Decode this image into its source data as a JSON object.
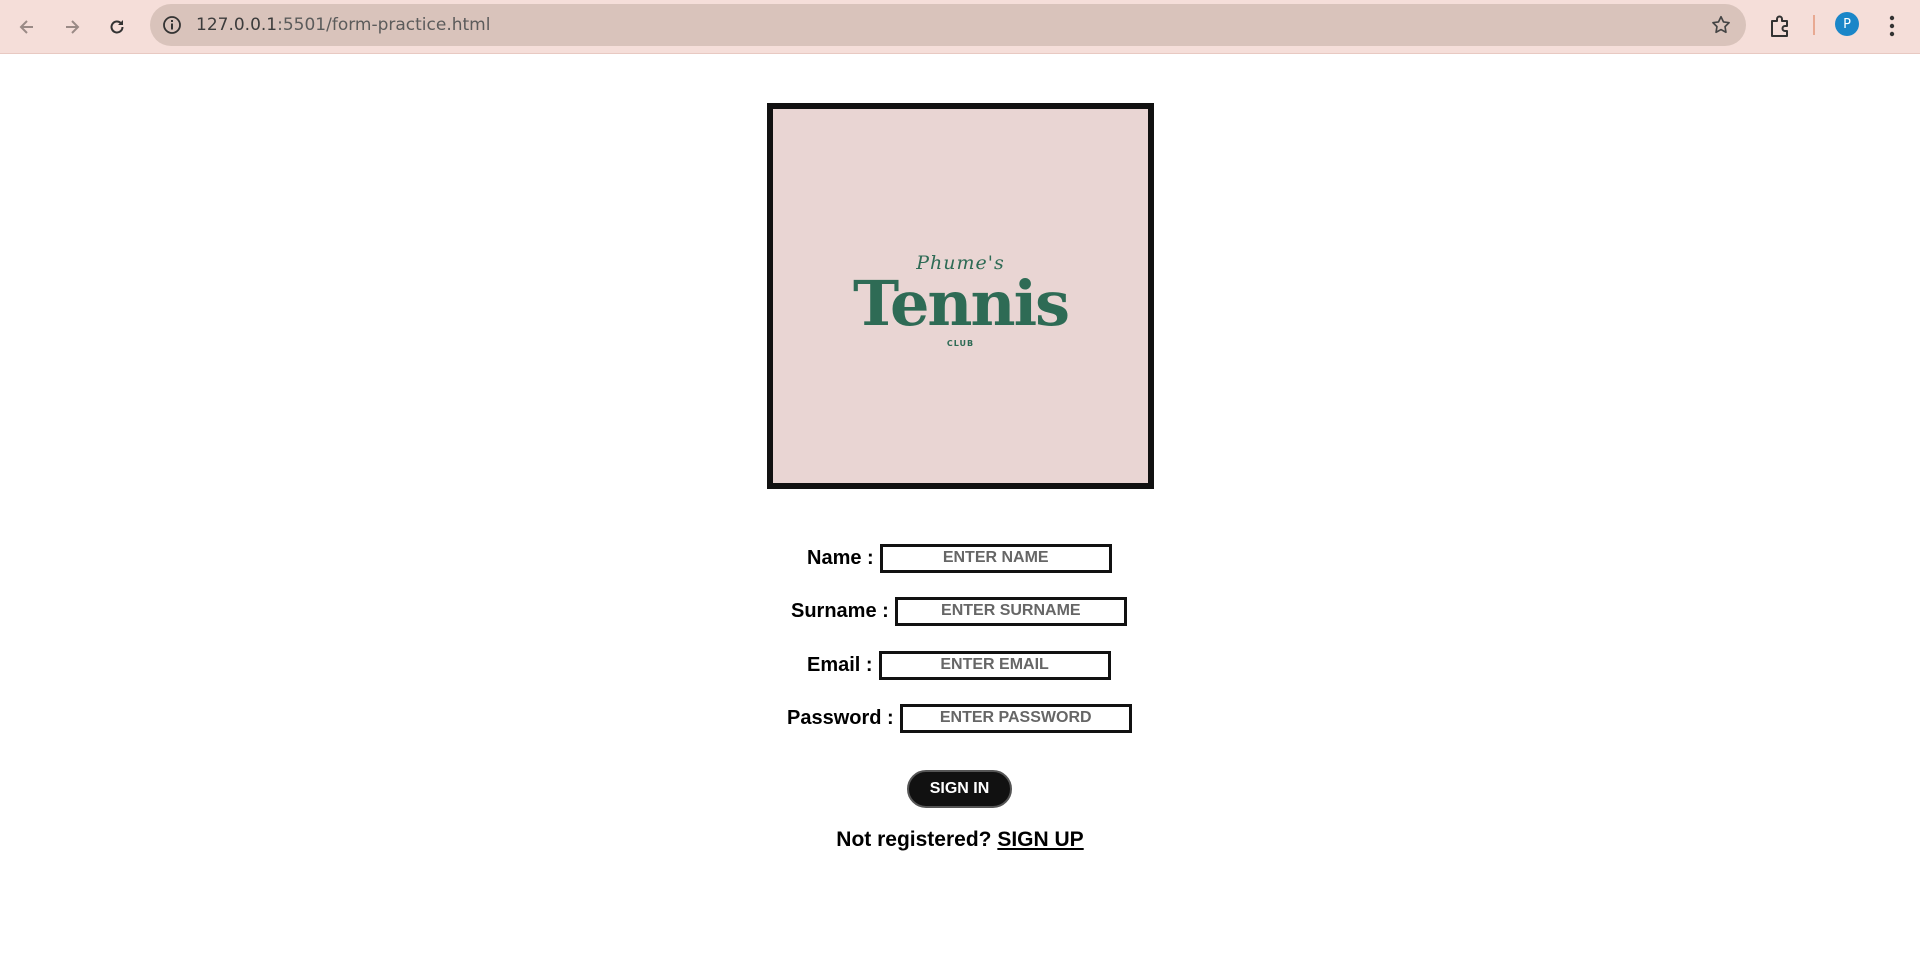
{
  "browser": {
    "url_host": "127.0.0.1",
    "url_path": ":5501/form-practice.html",
    "profile_initial": "P",
    "icons": [
      "back-icon",
      "forward-icon",
      "reload-icon",
      "info-icon",
      "star-icon",
      "extensions-icon",
      "menu-icon"
    ]
  },
  "logo": {
    "script_text": "Phume's",
    "title": "Tennis",
    "subtitle": "CLUB",
    "colors": {
      "background": "#e9d5d3",
      "text": "#2e6b55",
      "border": "#111111"
    }
  },
  "form": {
    "fields": [
      {
        "label": "Name :",
        "placeholder": "ENTER NAME"
      },
      {
        "label": "Surname :",
        "placeholder": "ENTER SURNAME"
      },
      {
        "label": "Email :",
        "placeholder": "ENTER EMAIL"
      },
      {
        "label": "Password :",
        "placeholder": "ENTER PASSWORD"
      }
    ],
    "submit_label": "SIGN IN",
    "signup_prompt": "Not registered?",
    "signup_link": "SIGN UP"
  }
}
